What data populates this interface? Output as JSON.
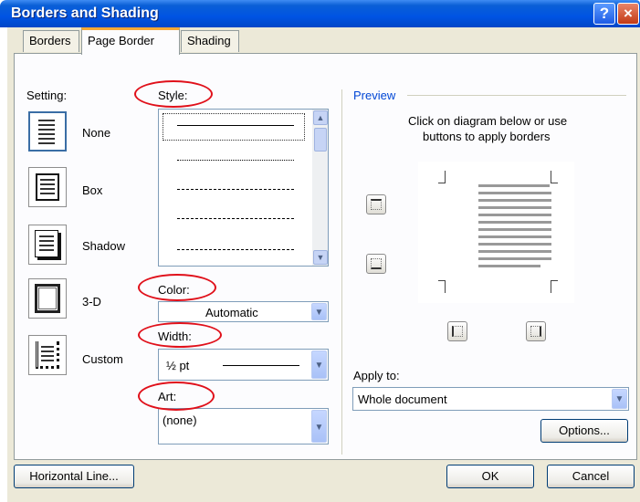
{
  "window": {
    "title": "Borders and Shading",
    "help": "?",
    "close": "×"
  },
  "tabs": [
    {
      "label": "Borders"
    },
    {
      "label": "Page Border"
    },
    {
      "label": "Shading"
    }
  ],
  "setting": {
    "label": "Setting:",
    "items": [
      {
        "label": "None"
      },
      {
        "label": "Box"
      },
      {
        "label": "Shadow"
      },
      {
        "label": "3-D"
      },
      {
        "label": "Custom"
      }
    ]
  },
  "style": {
    "label": "Style:"
  },
  "color": {
    "label": "Color:",
    "value": "Automatic"
  },
  "width": {
    "label": "Width:",
    "value": "½ pt"
  },
  "art": {
    "label": "Art:",
    "value": "(none)"
  },
  "preview": {
    "label": "Preview",
    "instruction_line1": "Click on diagram below or use",
    "instruction_line2": "buttons to apply borders"
  },
  "apply_to": {
    "label": "Apply to:",
    "value": "Whole document"
  },
  "buttons": {
    "options": "Options...",
    "horizontal_line": "Horizontal Line...",
    "ok": "OK",
    "cancel": "Cancel"
  },
  "colors": {
    "title_bar": "#0054e3",
    "dialog_bg": "#ece9d8",
    "annotation": "#e0101a"
  }
}
